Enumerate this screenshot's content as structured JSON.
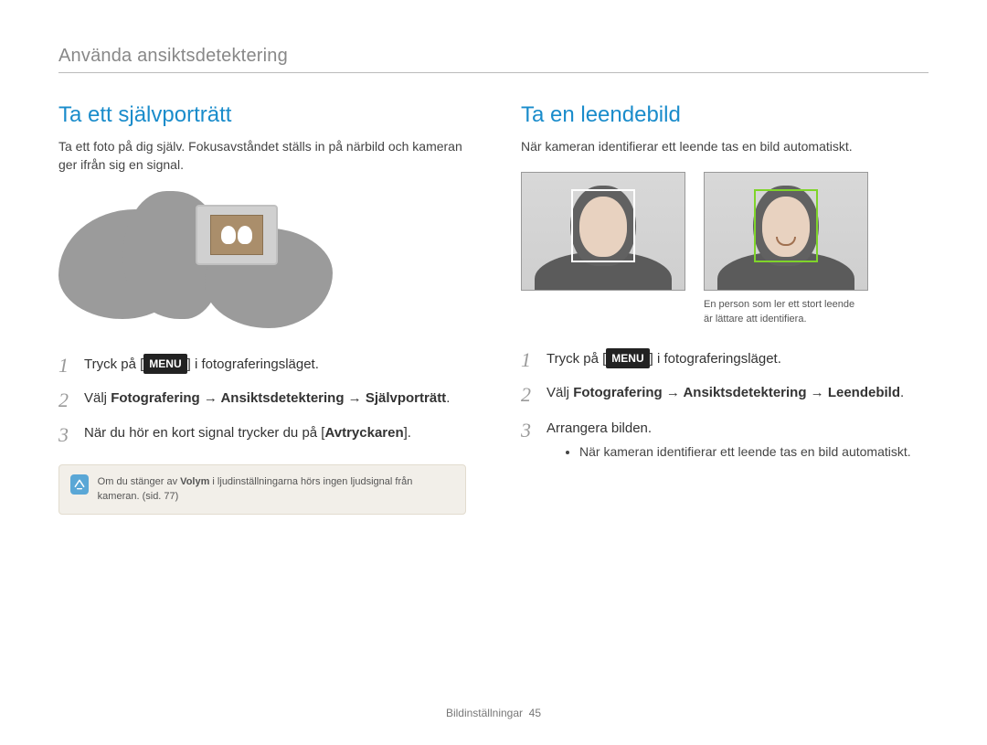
{
  "header": {
    "title": "Använda ansiktsdetektering"
  },
  "left": {
    "heading": "Ta ett självporträtt",
    "intro": "Ta ett foto på dig själv. Fokusavståndet ställs in på närbild och kameran ger ifrån sig en signal.",
    "steps": {
      "s1_pre": "Tryck på [",
      "s1_menu": "MENU",
      "s1_post": "] i fotograferingsläget.",
      "s2_pre": "Välj ",
      "s2_bold": "Fotografering → Ansiktsdetektering → Självporträtt",
      "s2_post": ".",
      "s3_pre": "När du hör en kort signal trycker du på [",
      "s3_bold": "Avtryckaren",
      "s3_post": "]."
    },
    "note_pre": "Om du stänger av ",
    "note_bold": "Volym",
    "note_post": " i ljudinställningarna hörs ingen ljudsignal från kameran. (sid. 77)"
  },
  "right": {
    "heading": "Ta en leendebild",
    "intro": "När kameran identifierar ett leende tas en bild automatiskt.",
    "caption_l1": "En person som ler ett stort leende",
    "caption_l2": "är lättare att identifiera.",
    "steps": {
      "s1_pre": "Tryck på [",
      "s1_menu": "MENU",
      "s1_post": "] i fotograferingsläget.",
      "s2_pre": "Välj ",
      "s2_bold": "Fotografering → Ansiktsdetektering → Leendebild",
      "s2_post": ".",
      "s3": "Arrangera bilden.",
      "s3_bullet": "När kameran identifierar ett leende tas en bild automatiskt."
    }
  },
  "step_numbers": {
    "one": "1",
    "two": "2",
    "three": "3"
  },
  "footer": {
    "section": "Bildinställningar",
    "page": "45"
  }
}
